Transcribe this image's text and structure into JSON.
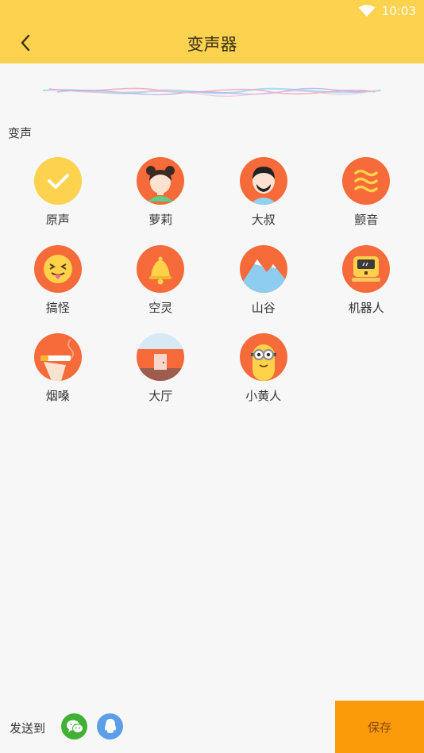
{
  "status": {
    "time": "10:03",
    "wifi_icon": "wifi-icon"
  },
  "header": {
    "title": "变声器",
    "back_icon": "back-arrow-icon"
  },
  "section": {
    "title": "变声"
  },
  "effects": [
    {
      "label": "原声",
      "icon": "check-icon",
      "selected": true
    },
    {
      "label": "萝莉",
      "icon": "girl-avatar-icon"
    },
    {
      "label": "大叔",
      "icon": "uncle-avatar-icon"
    },
    {
      "label": "颤音",
      "icon": "waves-icon"
    },
    {
      "label": "搞怪",
      "icon": "tongue-face-icon"
    },
    {
      "label": "空灵",
      "icon": "bell-icon"
    },
    {
      "label": "山谷",
      "icon": "mountain-icon"
    },
    {
      "label": "机器人",
      "icon": "robot-icon"
    },
    {
      "label": "烟嗓",
      "icon": "cigarette-icon"
    },
    {
      "label": "大厅",
      "icon": "hall-icon"
    },
    {
      "label": "小黄人",
      "icon": "minion-icon"
    }
  ],
  "footer": {
    "send_label": "发送到",
    "share_wechat_icon": "wechat-icon",
    "share_qq_icon": "qq-icon",
    "save_label": "保存"
  },
  "colors": {
    "brand_yellow": "#fcd24e",
    "icon_orange": "#f76a3a",
    "selected_yellow": "#fcd24e",
    "save_orange": "#fb9b0a",
    "wechat_green": "#41b035",
    "qq_blue": "#5d9ee9"
  }
}
